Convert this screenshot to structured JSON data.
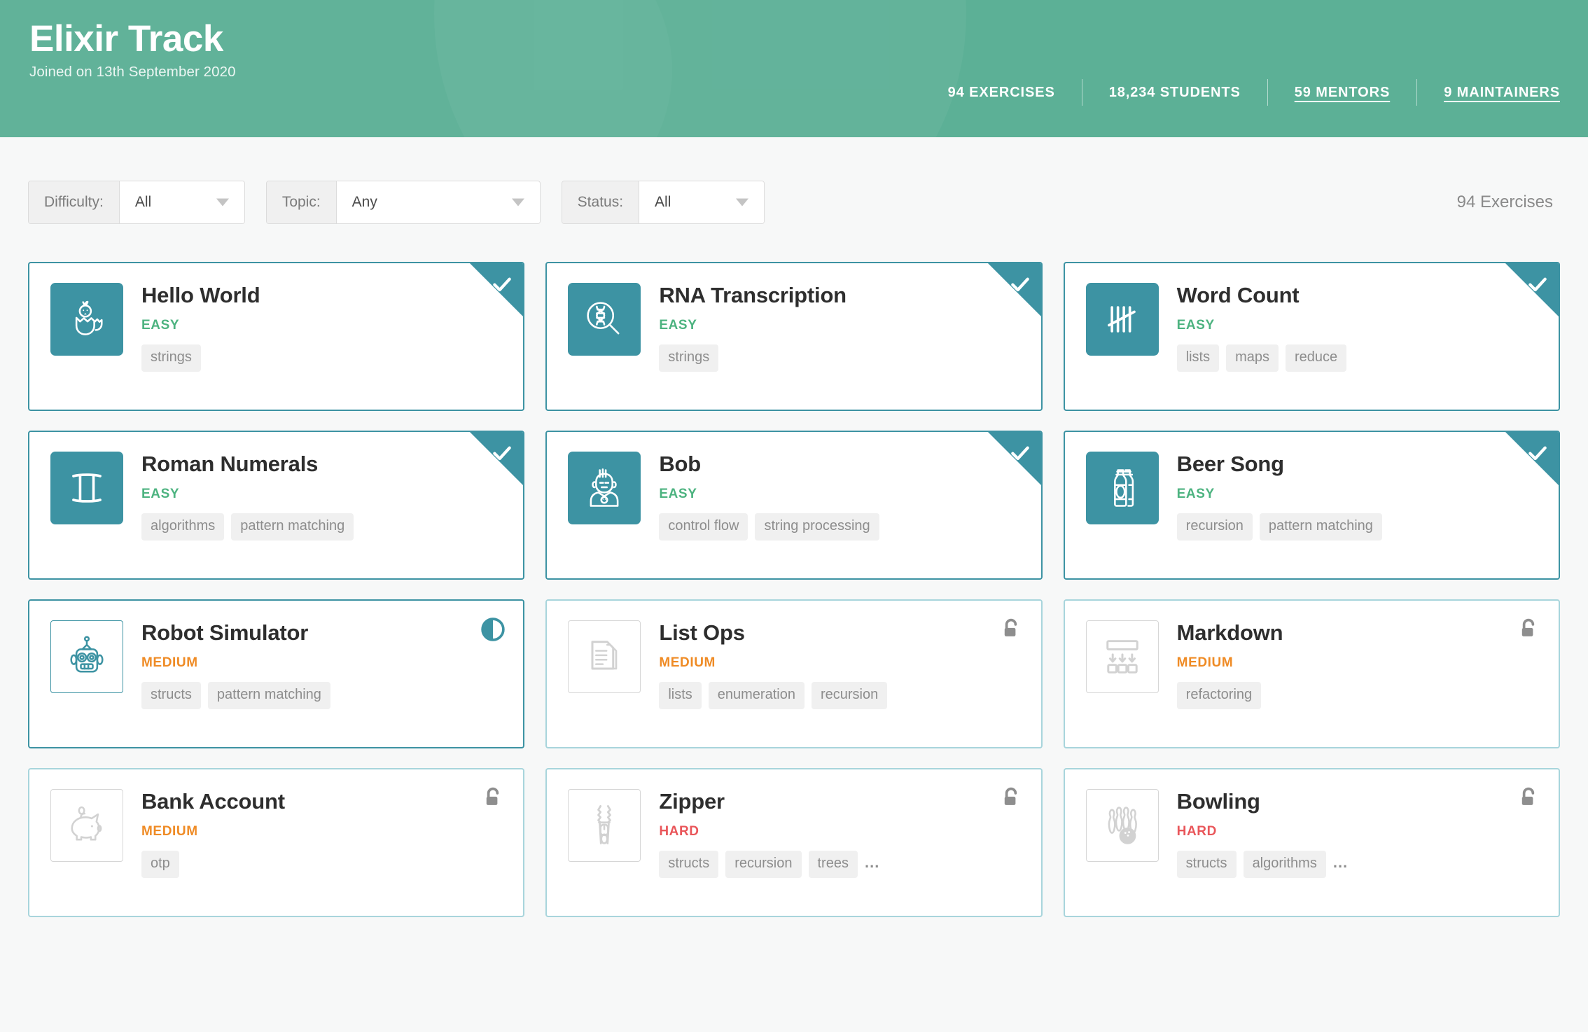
{
  "header": {
    "title": "Elixir Track",
    "joined": "Joined on 13th September 2020",
    "stats": [
      {
        "label": "94 EXERCISES",
        "link": false
      },
      {
        "label": "18,234 STUDENTS",
        "link": false
      },
      {
        "label": "59 MENTORS",
        "link": true
      },
      {
        "label": "9 MAINTAINERS",
        "link": true
      }
    ]
  },
  "filters": {
    "difficulty": {
      "label": "Difficulty:",
      "value": "All"
    },
    "topic": {
      "label": "Topic:",
      "value": "Any"
    },
    "status": {
      "label": "Status:",
      "value": "All"
    },
    "count": "94 Exercises"
  },
  "exercises": [
    {
      "title": "Hello World",
      "difficulty": "EASY",
      "difficulty_class": "diff-easy",
      "tags": [
        "strings"
      ],
      "more": "",
      "state": "completed",
      "icon": "chick-hatching-icon"
    },
    {
      "title": "RNA Transcription",
      "difficulty": "EASY",
      "difficulty_class": "diff-easy",
      "tags": [
        "strings"
      ],
      "more": "",
      "state": "completed",
      "icon": "dna-magnifier-icon"
    },
    {
      "title": "Word Count",
      "difficulty": "EASY",
      "difficulty_class": "diff-easy",
      "tags": [
        "lists",
        "maps",
        "reduce"
      ],
      "more": "",
      "state": "completed",
      "icon": "tally-marks-icon"
    },
    {
      "title": "Roman Numerals",
      "difficulty": "EASY",
      "difficulty_class": "diff-easy",
      "tags": [
        "algorithms",
        "pattern matching"
      ],
      "more": "",
      "state": "completed",
      "icon": "roman-numeral-two-icon"
    },
    {
      "title": "Bob",
      "difficulty": "EASY",
      "difficulty_class": "diff-easy",
      "tags": [
        "control flow",
        "string processing"
      ],
      "more": "",
      "state": "completed",
      "icon": "teenager-icon"
    },
    {
      "title": "Beer Song",
      "difficulty": "EASY",
      "difficulty_class": "diff-easy",
      "tags": [
        "recursion",
        "pattern matching"
      ],
      "more": "",
      "state": "completed",
      "icon": "beer-bottles-icon"
    },
    {
      "title": "Robot Simulator",
      "difficulty": "MEDIUM",
      "difficulty_class": "diff-medium",
      "tags": [
        "structs",
        "pattern matching"
      ],
      "more": "",
      "state": "in-progress",
      "icon": "robot-icon"
    },
    {
      "title": "List Ops",
      "difficulty": "MEDIUM",
      "difficulty_class": "diff-medium",
      "tags": [
        "lists",
        "enumeration",
        "recursion"
      ],
      "more": "",
      "state": "locked",
      "icon": "documents-icon"
    },
    {
      "title": "Markdown",
      "difficulty": "MEDIUM",
      "difficulty_class": "diff-medium",
      "tags": [
        "refactoring"
      ],
      "more": "",
      "state": "locked",
      "icon": "markdown-transform-icon"
    },
    {
      "title": "Bank Account",
      "difficulty": "MEDIUM",
      "difficulty_class": "diff-medium",
      "tags": [
        "otp"
      ],
      "more": "",
      "state": "locked",
      "icon": "piggy-bank-icon"
    },
    {
      "title": "Zipper",
      "difficulty": "HARD",
      "difficulty_class": "diff-hard",
      "tags": [
        "structs",
        "recursion",
        "trees"
      ],
      "more": "...",
      "state": "locked",
      "icon": "zipper-icon"
    },
    {
      "title": "Bowling",
      "difficulty": "HARD",
      "difficulty_class": "diff-hard",
      "tags": [
        "structs",
        "algorithms"
      ],
      "more": "...",
      "state": "locked",
      "icon": "bowling-pins-icon"
    }
  ],
  "colors": {
    "header_green": "#5cb096",
    "teal": "#3d93a3",
    "locked_border": "#a8d5dc",
    "easy": "#4db380",
    "medium": "#ef8b25",
    "hard": "#e9565a",
    "page_bg": "#f7f8f8"
  }
}
